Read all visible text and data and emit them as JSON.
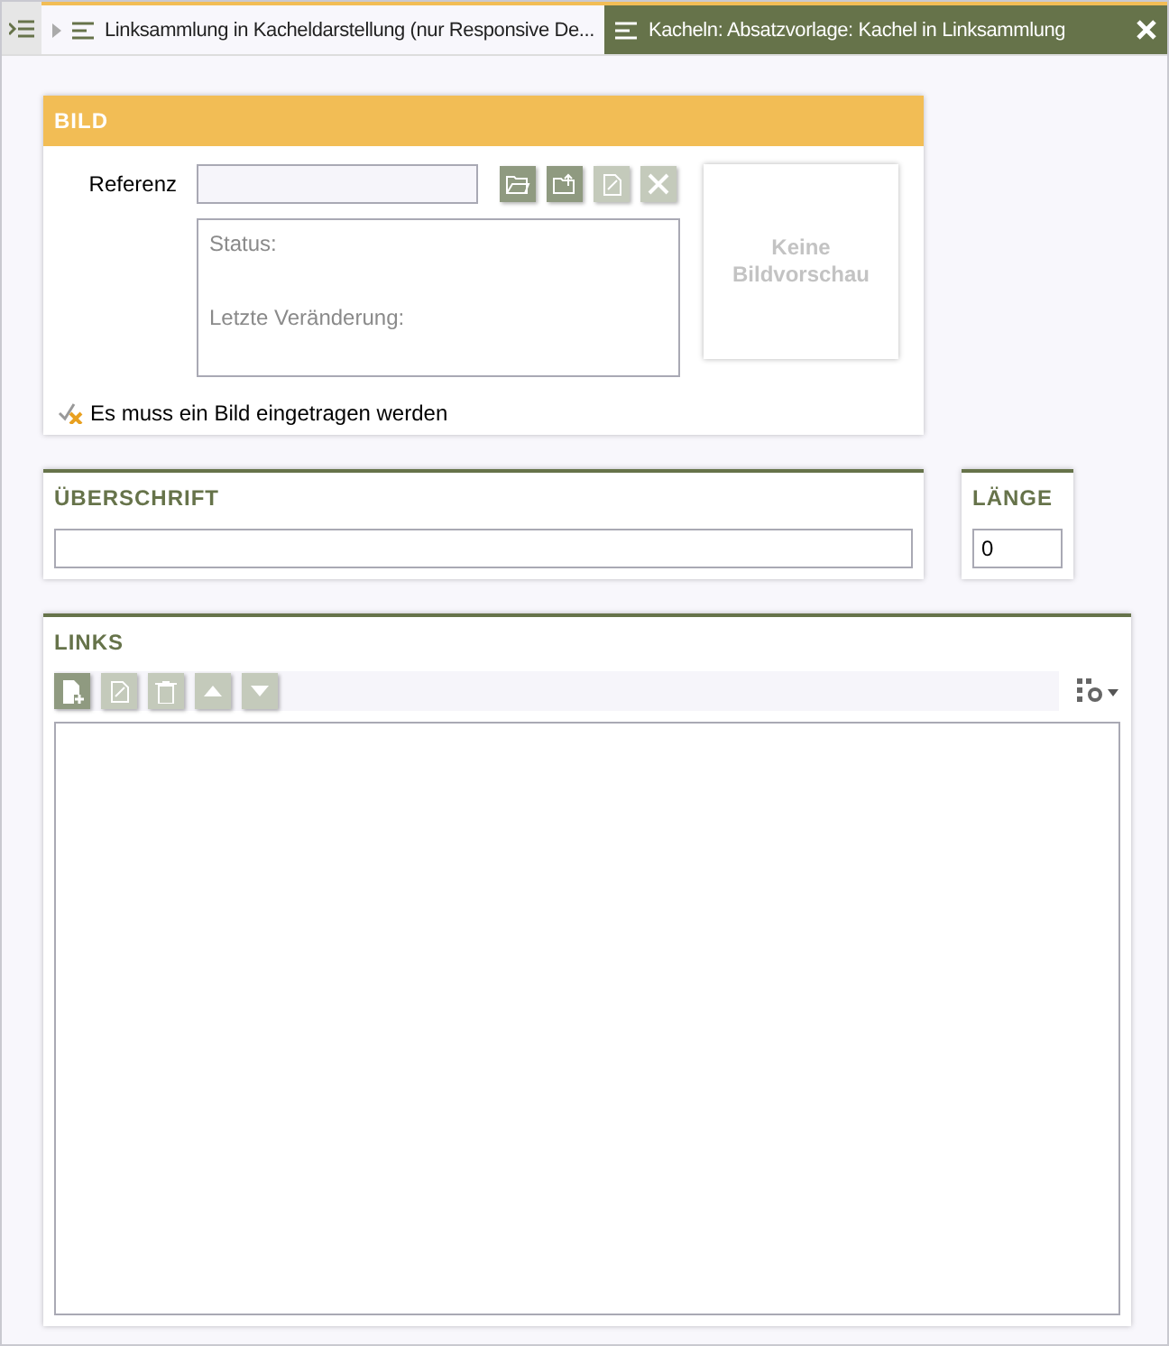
{
  "tabs": [
    {
      "label": "Linksammlung in Kacheldarstellung (nur Responsive De...",
      "selected": false
    },
    {
      "label": "Kacheln: Absatzvorlage: Kachel in Linksammlung",
      "selected": true
    }
  ],
  "bild": {
    "title": "BILD",
    "reference_label": "Referenz",
    "buttons": [
      {
        "kind": "open",
        "disabled": false
      },
      {
        "kind": "upload",
        "disabled": false
      },
      {
        "kind": "edit",
        "disabled": true
      },
      {
        "kind": "remove",
        "disabled": true
      }
    ],
    "status_label": "Status:",
    "last_change_label": "Letzte Veränderung:",
    "preview": "Keine Bildvorschau",
    "warning": "Es muss ein Bild eingetragen werden"
  },
  "heading": {
    "title": "ÜBERSCHRIFT"
  },
  "length": {
    "title": "LÄNGE",
    "value": "0"
  },
  "links": {
    "title": "LINKS",
    "buttons": [
      {
        "kind": "add",
        "disabled": false
      },
      {
        "kind": "edit",
        "disabled": true
      },
      {
        "kind": "delete",
        "disabled": true
      },
      {
        "kind": "up",
        "disabled": true
      },
      {
        "kind": "down",
        "disabled": true
      }
    ]
  }
}
